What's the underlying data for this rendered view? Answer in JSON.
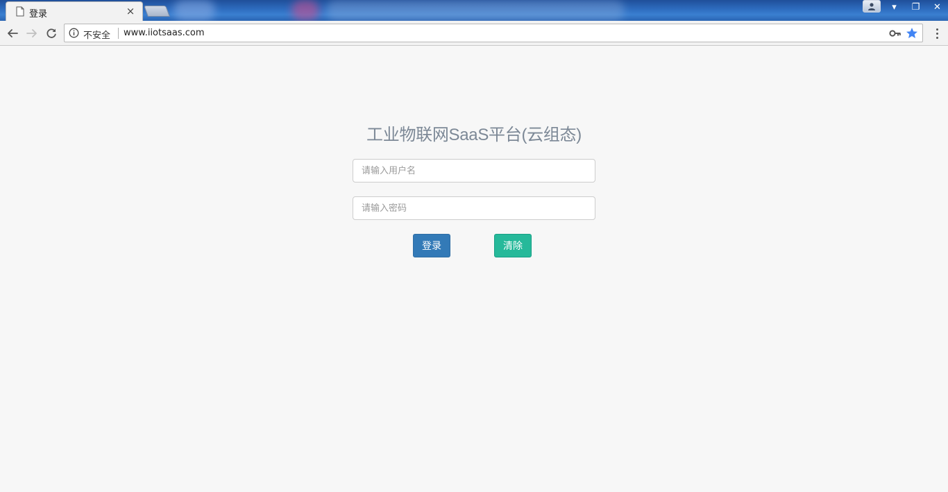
{
  "browser": {
    "tab": {
      "title": "登录",
      "close_glyph": "×",
      "icon": "page-icon"
    },
    "window_controls": {
      "user_icon": "user-icon",
      "minimize_glyph": "▾",
      "restore_glyph": "❐",
      "close_glyph": "✕"
    },
    "toolbar": {
      "back_icon": "arrow-left-icon",
      "forward_icon": "arrow-right-icon",
      "reload_icon": "reload-icon",
      "security_label": "不安全",
      "url": "www.iiotsaas.com",
      "key_icon": "key-icon",
      "bookmark_icon": "star-icon",
      "menu_icon": "kebab-menu-icon"
    }
  },
  "page": {
    "title": "工业物联网SaaS平台(云组态)",
    "username": {
      "value": "",
      "placeholder": "请输入用户名"
    },
    "password": {
      "value": "",
      "placeholder": "请输入密码"
    },
    "login_button": "登录",
    "clear_button": "清除"
  },
  "colors": {
    "title": "#7c8896",
    "login_button": "#337ab7",
    "clear_button": "#26b99a",
    "page_background": "#f7f7f7"
  }
}
